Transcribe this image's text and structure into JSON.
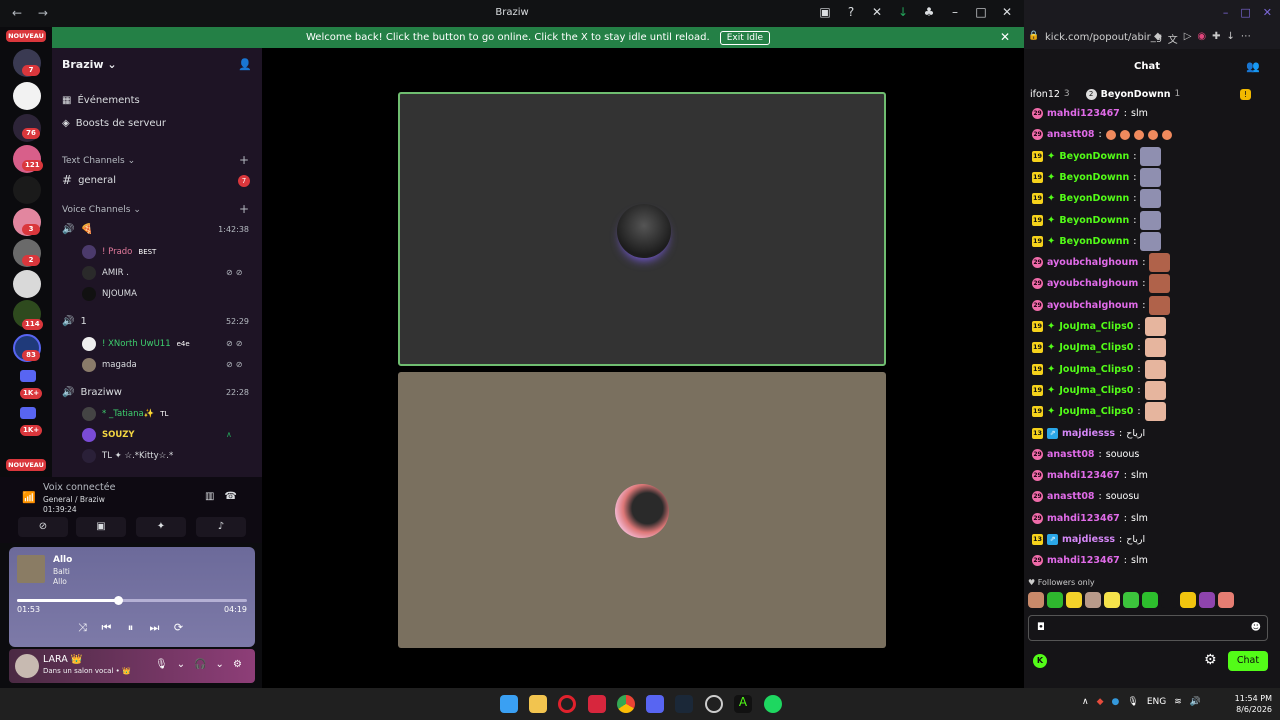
{
  "titlebar": {
    "title": "Braziw"
  },
  "banner": {
    "text": "Welcome back! Click the button to go online. Click the X to stay idle until reload.",
    "button": "Exit Idle"
  },
  "servers": {
    "top_badge": "NOUVEAU",
    "bottom_badge": "NOUVEAU",
    "badges": [
      "7",
      "76",
      "121",
      "3",
      "2",
      "114",
      "83",
      "1K+",
      "1K+"
    ]
  },
  "guild": {
    "name": "Braziw",
    "events": "Événements",
    "boosts": "Boosts de serveur",
    "text_category": "Text Channels",
    "text_channels": [
      {
        "name": "general",
        "unread": "7"
      }
    ],
    "voice_category": "Voice Channels",
    "voice_channels": [
      {
        "name": "🍕",
        "time": "1:42:38",
        "members": [
          {
            "name": "! Prado",
            "tag": "BEST"
          },
          {
            "name": "AMIR ."
          },
          {
            "name": "NJOUMA"
          }
        ]
      },
      {
        "name": "1",
        "time": "52:29",
        "members": [
          {
            "name": "! XNorth UwU11",
            "tag": "e4e"
          },
          {
            "name": "magada"
          }
        ]
      },
      {
        "name": "Braziww",
        "time": "22:28",
        "members": [
          {
            "name": "* _Tatiana✨",
            "tag": "TL"
          },
          {
            "name": "SOUZY"
          },
          {
            "name": "TL ✦ ☆.*Kitty☆.*"
          }
        ]
      }
    ]
  },
  "voice_panel": {
    "title": "Voix connectée",
    "channel": "General / Braziw",
    "elapsed": "01:39:24"
  },
  "player": {
    "song": "Allo",
    "artist": "Balti",
    "album": "Allo",
    "current": "01:53",
    "total": "04:19",
    "progress": 0.44
  },
  "user": {
    "name": "LARA 👑",
    "status": "Dans un salon vocal • 👑"
  },
  "browser": {
    "url": "kick.com/popout/abir_g"
  },
  "chat": {
    "title": "Chat",
    "pinned": {
      "left": "ifon12",
      "left_count": "3",
      "middle": "BeyonDownn",
      "middle_count": "1"
    },
    "messages": [
      {
        "user": "mahdi123467",
        "text": "slm",
        "color": "#e06be8",
        "badge": "round"
      },
      {
        "user": "anastt08",
        "text": "",
        "color": "#e06be8",
        "badge": "round",
        "emotes": "laugh"
      },
      {
        "user": "BeyonDownn",
        "text": "",
        "color": "#53fc18",
        "badge": "sub19",
        "emote": "person"
      },
      {
        "user": "BeyonDownn",
        "text": "",
        "color": "#53fc18",
        "badge": "sub19",
        "emote": "person"
      },
      {
        "user": "BeyonDownn",
        "text": "",
        "color": "#53fc18",
        "badge": "sub19",
        "emote": "person"
      },
      {
        "user": "BeyonDownn",
        "text": "",
        "color": "#53fc18",
        "badge": "sub19",
        "emote": "person"
      },
      {
        "user": "BeyonDownn",
        "text": "",
        "color": "#53fc18",
        "badge": "sub19",
        "emote": "person"
      },
      {
        "user": "ayoubchalghoum",
        "text": "",
        "color": "#e06be8",
        "badge": "round",
        "emote": "face"
      },
      {
        "user": "ayoubchalghoum",
        "text": "",
        "color": "#e06be8",
        "badge": "round",
        "emote": "face"
      },
      {
        "user": "ayoubchalghoum",
        "text": "",
        "color": "#e06be8",
        "badge": "round",
        "emote": "face"
      },
      {
        "user": "JouJma_Clips0",
        "text": "",
        "color": "#53fc18",
        "badge": "sub19",
        "emote": "skin"
      },
      {
        "user": "JouJma_Clips0",
        "text": "",
        "color": "#53fc18",
        "badge": "sub19",
        "emote": "skin"
      },
      {
        "user": "JouJma_Clips0",
        "text": "",
        "color": "#53fc18",
        "badge": "sub19",
        "emote": "skin"
      },
      {
        "user": "JouJma_Clips0",
        "text": "",
        "color": "#53fc18",
        "badge": "sub19",
        "emote": "skin"
      },
      {
        "user": "JouJma_Clips0",
        "text": "",
        "color": "#53fc18",
        "badge": "sub19",
        "emote": "skin"
      },
      {
        "user": "majdiesss",
        "text": "ارياح",
        "color": "#d486f6",
        "badge": "sub13"
      },
      {
        "user": "anastt08",
        "text": "souous",
        "color": "#e06be8",
        "badge": "round"
      },
      {
        "user": "mahdi123467",
        "text": "slm",
        "color": "#e06be8",
        "badge": "round"
      },
      {
        "user": "anastt08",
        "text": "souosu",
        "color": "#e06be8",
        "badge": "round"
      },
      {
        "user": "mahdi123467",
        "text": "slm",
        "color": "#e06be8",
        "badge": "round"
      },
      {
        "user": "majdiesss",
        "text": "ارياح",
        "color": "#d486f6",
        "badge": "sub13"
      },
      {
        "user": "mahdi123467",
        "text": "slm",
        "color": "#e06be8",
        "badge": "round"
      }
    ],
    "followers_only": "Followers only",
    "send": "Chat"
  },
  "taskbar": {
    "lang": "ENG",
    "time": "11:54 PM",
    "date": "8/6/2026"
  }
}
